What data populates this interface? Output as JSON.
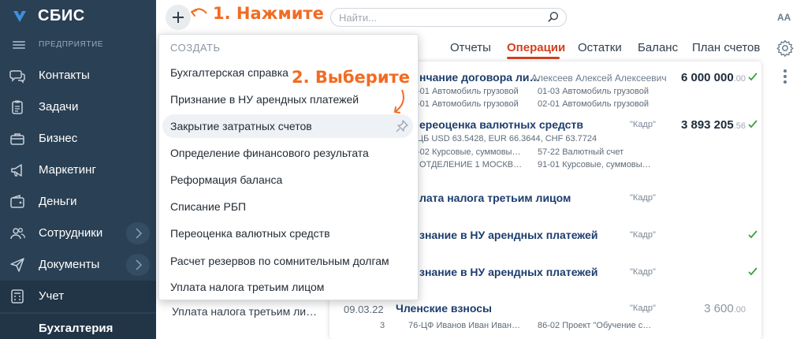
{
  "app": {
    "name": "СБИС"
  },
  "sidebar": {
    "org_label": "ПРЕДПРИЯТИЕ",
    "items": [
      {
        "label": "Контакты",
        "icon": "chat-bubbles-icon"
      },
      {
        "label": "Задачи",
        "icon": "clipboard-icon"
      },
      {
        "label": "Бизнес",
        "icon": "briefcase-icon"
      },
      {
        "label": "Маркетинг",
        "icon": "megaphone-icon"
      },
      {
        "label": "Деньги",
        "icon": "wallet-icon"
      },
      {
        "label": "Сотрудники",
        "icon": "people-icon",
        "has_submenu": true
      },
      {
        "label": "Документы",
        "icon": "paper-plane-icon",
        "has_submenu": true
      },
      {
        "label": "Учет",
        "icon": "calculator-icon",
        "active": true
      }
    ],
    "sub_item": "Бухгалтерия"
  },
  "toolbar": {
    "search_placeholder": "Найти...",
    "font_size_toggle": "AA"
  },
  "hints": {
    "step1": "1. Нажмите",
    "step2": "2. Выберите"
  },
  "tabs": [
    {
      "label": "Отчеты"
    },
    {
      "label": "Операции",
      "active": true
    },
    {
      "label": "Остатки"
    },
    {
      "label": "Баланс"
    },
    {
      "label": "План счетов"
    }
  ],
  "create_menu": {
    "header": "СОЗДАТЬ",
    "items": [
      "Бухгалтерская справка",
      "Признание в НУ арендных платежей",
      "Закрытие затратных счетов",
      "Определение финансового результата",
      "Реформация баланса",
      "Списание РБП",
      "Переоценка валютных средств",
      "Расчет резервов по сомнительным долгам",
      "Уплата налога третьим лицом"
    ],
    "hovered_index": 2
  },
  "operations": [
    {
      "title": "…нчание договора ли…",
      "author": "Алексеев Алексей Алексеевич",
      "amount_main": "6 000 000",
      "amount_cents": ".00",
      "checked": true,
      "lines": [
        "…-01 Автомобиль грузовой",
        "01-03 Автомобиль грузовой",
        "…-01 Автомобиль грузовой",
        "02-01 Автомобиль грузовой"
      ]
    },
    {
      "title": "…ереоценка валютных средств",
      "author": "\"Кадр\"",
      "amount_main": "3 893 205",
      "amount_cents": ".56",
      "checked": true,
      "lines": [
        "…ЦБ USD 63.5428, EUR 66.3644, CHF 63.7724",
        "…-02 Курсовые, суммовы…",
        "57-22 Валютный счет",
        "… ОТДЕЛЕНИЕ 1 МОСКВ…",
        "91-01 Курсовые, суммовы…"
      ]
    },
    {
      "title": "…лата налога третьим лицом",
      "author": "\"Кадр\"",
      "checked": false
    },
    {
      "title": "…знание в НУ арендных платежей",
      "author": "\"Кадр\"",
      "checked": true
    },
    {
      "title": "…знание в НУ арендных платежей",
      "author": "\"Кадр\"",
      "checked": true
    },
    {
      "date": "09.03.22",
      "num": "3",
      "title": "Членские взносы",
      "author": "\"Кадр\"",
      "amount_main": "3 600",
      "amount_cents": ".00",
      "checked": false,
      "lines": [
        "76-ЦФ Иванов Иван Иван…",
        "86-02 Проект \"Обучение с…"
      ]
    }
  ],
  "background_list_item": "Уплата налога третьим ли…",
  "colors": {
    "sidebar": "#2a4054",
    "accent": "#d2411c",
    "hint": "#f26b21",
    "check": "#3aa245",
    "link": "#1c3d6e"
  }
}
